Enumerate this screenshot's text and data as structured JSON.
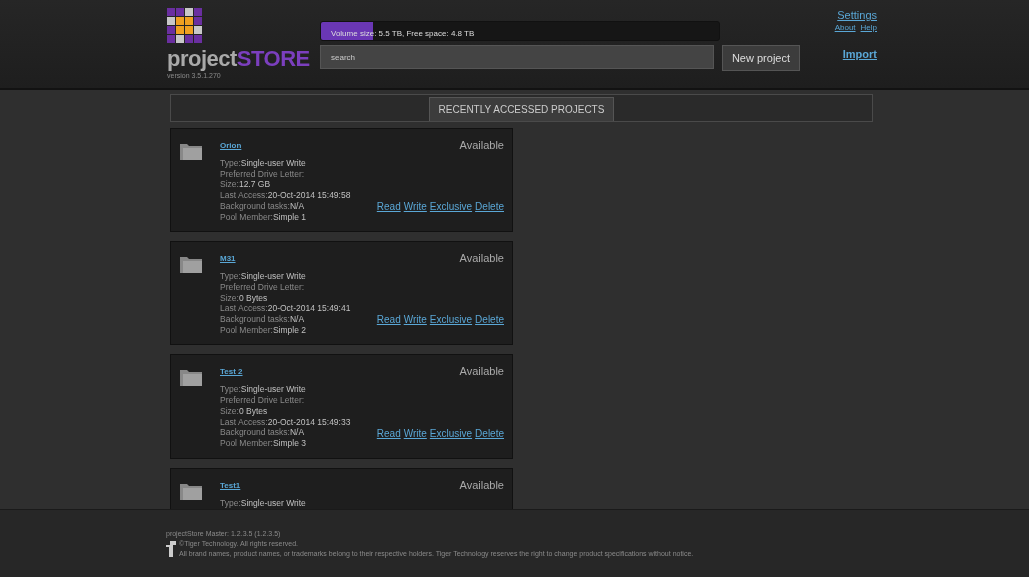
{
  "header": {
    "logo": {
      "part_1": "project",
      "part_2": "STORE"
    },
    "version": "version 3.5.1.270",
    "volume": {
      "text": "Volume size: 5.5 TB, Free space: 4.8 TB",
      "level": 0.13
    },
    "search": {
      "placeholder": "search"
    },
    "new_project_button": "New project",
    "links": {
      "settings": "Settings",
      "about": "About",
      "help": "Help",
      "import": "Import"
    }
  },
  "tabs": [
    {
      "label": "RECENTLY ACCESSED PROJECTS",
      "selected": true
    }
  ],
  "projects": [
    {
      "name": "Orion",
      "status": "Available",
      "fields": [
        {
          "label": "Type:",
          "value": "Single-user Write"
        },
        {
          "label": "Preferred Drive Letter:"
        },
        {
          "label": "Size:",
          "value": "12.7 GB"
        },
        {
          "label": "Last Access:",
          "value": "20-Oct-2014 15:49:58"
        },
        {
          "label": "Background tasks:",
          "value": "N/A"
        },
        {
          "label": "Pool Member:",
          "value": "Simple 1"
        }
      ],
      "actions": [
        "Read",
        "Write",
        "Exclusive",
        "Delete"
      ]
    },
    {
      "name": "M31",
      "status": "Available",
      "fields": [
        {
          "label": "Type:",
          "value": "Single-user Write"
        },
        {
          "label": "Preferred Drive Letter:"
        },
        {
          "label": "Size:",
          "value": "0 Bytes"
        },
        {
          "label": "Last Access:",
          "value": "20-Oct-2014 15:49:41"
        },
        {
          "label": "Background tasks:",
          "value": "N/A"
        },
        {
          "label": "Pool Member:",
          "value": "Simple 2"
        }
      ],
      "actions": [
        "Read",
        "Write",
        "Exclusive",
        "Delete"
      ]
    },
    {
      "name": "Test 2",
      "status": "Available",
      "fields": [
        {
          "label": "Type:",
          "value": "Single-user Write"
        },
        {
          "label": "Preferred Drive Letter:"
        },
        {
          "label": "Size:",
          "value": "0 Bytes"
        },
        {
          "label": "Last Access:",
          "value": "20-Oct-2014 15:49:33"
        },
        {
          "label": "Background tasks:",
          "value": "N/A"
        },
        {
          "label": "Pool Member:",
          "value": "Simple 3"
        }
      ],
      "actions": [
        "Read",
        "Write",
        "Exclusive",
        "Delete"
      ]
    },
    {
      "name": "Test1",
      "status": "Available",
      "fields": [
        {
          "label": "Type:",
          "value": "Single-user Write"
        }
      ]
    }
  ],
  "footer": {
    "master": "projectStore Master: 1.2.3.5 (1.2.3.5)",
    "copyright": "©Tiger Technology. All rights reserved.",
    "notice": "All brand names, product names, or trademarks belong to their respective holders. Tiger Technology reserves the right to change product specifications without notice."
  }
}
